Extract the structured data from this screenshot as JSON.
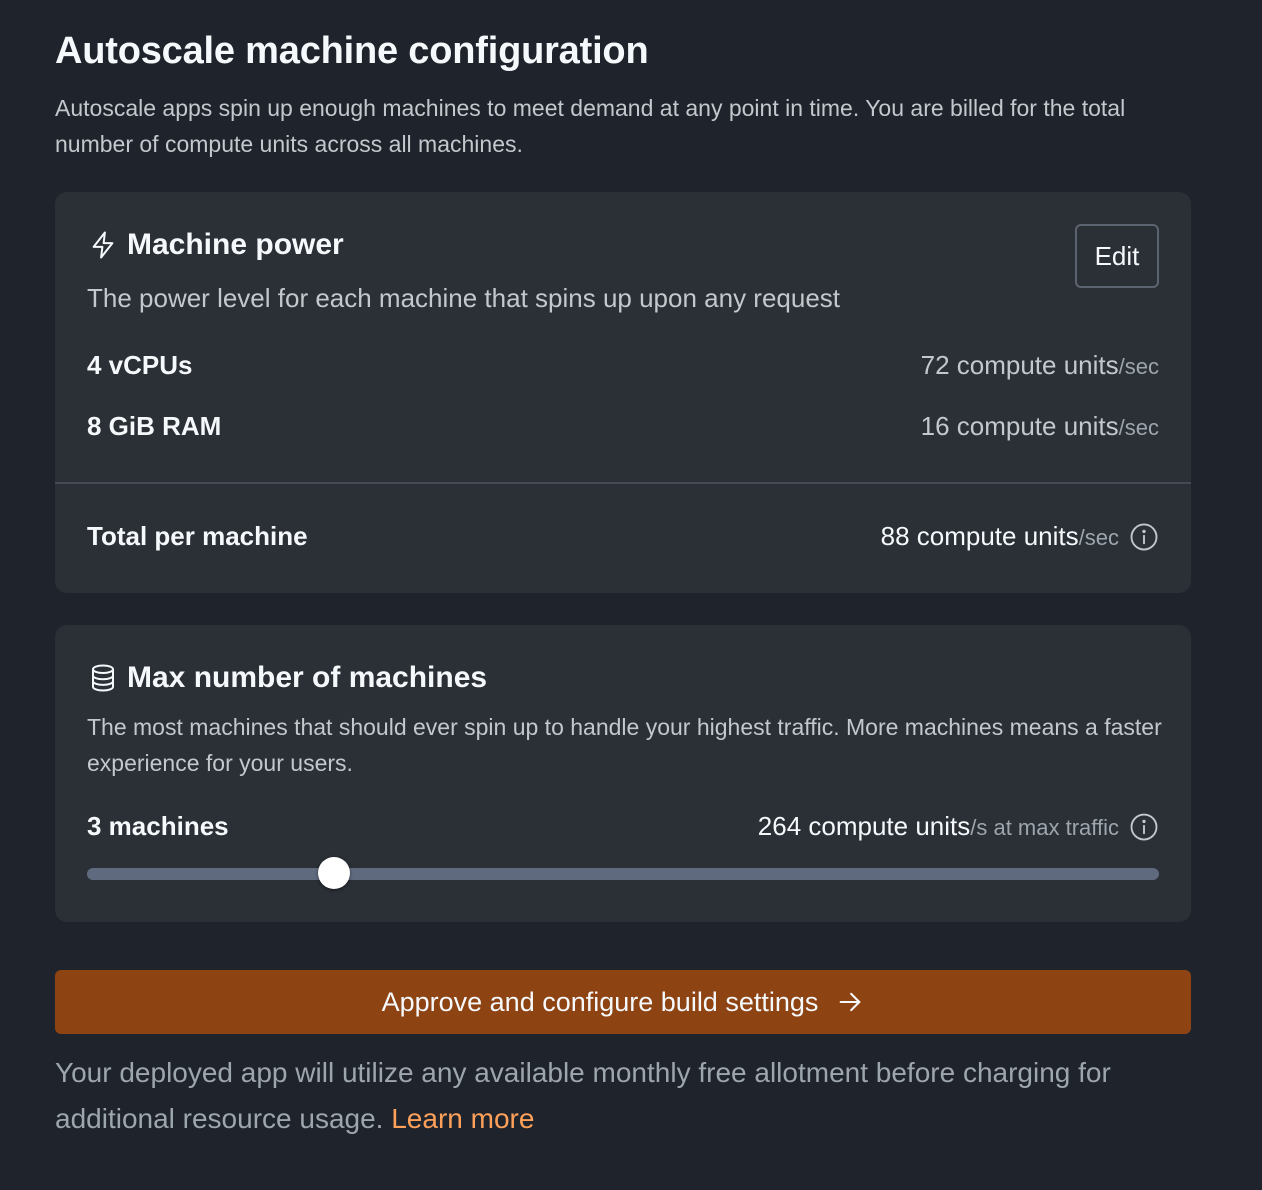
{
  "header": {
    "title": "Autoscale machine configuration",
    "description": "Autoscale apps spin up enough machines to meet demand at any point in time. You are billed for the total number of compute units across all machines."
  },
  "machine_power": {
    "title": "Machine power",
    "icon": "lightning-icon",
    "description": "The power level for each machine that spins up upon any request",
    "edit_label": "Edit",
    "rows": [
      {
        "label": "4 vCPUs",
        "value": "72 compute units",
        "unit": "/sec"
      },
      {
        "label": "8 GiB RAM",
        "value": "16 compute units",
        "unit": "/sec"
      }
    ],
    "total": {
      "label": "Total per machine",
      "value": "88 compute units",
      "unit": "/sec"
    }
  },
  "max_machines": {
    "title": "Max number of machines",
    "icon": "database-icon",
    "description": "The most machines that should ever spin up to handle your highest traffic. More machines means a faster experience for your users.",
    "count_label": "3 machines",
    "value": "264 compute units",
    "unit": "/s at max traffic",
    "slider_fraction": 0.23
  },
  "approve": {
    "label": "Approve and configure build settings",
    "icon": "arrow-right-icon"
  },
  "footer": {
    "text": "Your deployed app will utilize any available monthly free allotment before charging for additional resource usage.",
    "link": "Learn more"
  },
  "colors": {
    "background": "#1f232b",
    "card": "#2b2f36",
    "accent_button": "#8e4313",
    "link": "#ffa15a"
  }
}
